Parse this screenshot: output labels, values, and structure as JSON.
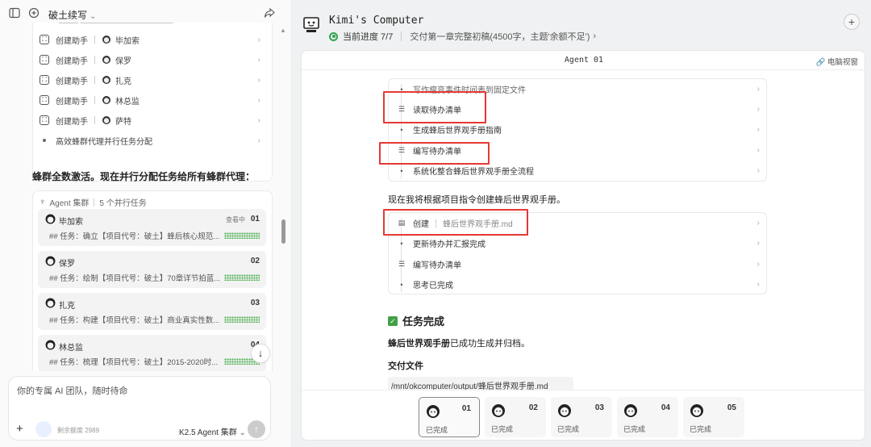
{
  "left": {
    "project_title": "破土续写",
    "card_rows": [
      {
        "type": "helper",
        "label": "创建助手",
        "agent": "毕加索"
      },
      {
        "type": "helper",
        "label": "创建助手",
        "agent": "保罗"
      },
      {
        "type": "helper",
        "label": "创建助手",
        "agent": "扎克"
      },
      {
        "type": "helper",
        "label": "创建助手",
        "agent": "林总监"
      },
      {
        "type": "helper",
        "label": "创建助手",
        "agent": "萨特"
      },
      {
        "type": "bullet",
        "label": "高效蜂群代理并行任务分配"
      }
    ],
    "swarm_message": "蜂群全数激活。现在并行分配任务给所有蜂群代理：",
    "agents_header": {
      "label": "Agent 集群",
      "count": "5 个并行任务"
    },
    "agents": [
      {
        "name": "毕加索",
        "num": "01",
        "view": "查看中",
        "task": "## 任务：确立【项目代号：破土】蜂后核心规范..."
      },
      {
        "name": "保罗",
        "num": "02",
        "view": "",
        "task": "## 任务：绘制【项目代号：破土】70章详节拍蓝..."
      },
      {
        "name": "扎克",
        "num": "03",
        "view": "",
        "task": "## 任务：构建【项目代号：破土】商业真实性数..."
      },
      {
        "name": "林总监",
        "num": "04",
        "view": "",
        "task": "## 任务：梳理【项目代号：破土】2015-2020时..."
      }
    ],
    "input": {
      "placeholder": "你的专属 AI 团队，随时待命",
      "quota": "剩余额度 2989",
      "model": "K2.5 Agent 集群"
    }
  },
  "right": {
    "computer_title": "Kimi's Computer",
    "progress_label": "当前进度 7/7",
    "progress_value": 1.0,
    "progress_desc": "交付第一章完整初稿(4500字，主题'余额不足')",
    "panel_title": "Agent 01",
    "panel_view": "电脑视窗",
    "steps_group1": [
      {
        "marker": "dot",
        "label": "写作瘤变事件时间表到固定文件"
      },
      {
        "marker": "list",
        "label": "读取待办清单"
      },
      {
        "marker": "dot",
        "label": "生成蜂后世界观手册指南"
      },
      {
        "marker": "list",
        "label": "编写待办清单"
      },
      {
        "marker": "dot",
        "label": "系统化整合蜂后世界观手册全流程"
      }
    ],
    "mid_text": "现在我将根据项目指令创建蜂后世界观手册。",
    "steps_group2": [
      {
        "marker": "file",
        "label": "创建",
        "extra": "蜂后世界观手册.md"
      },
      {
        "marker": "dot",
        "label": "更新待办并汇报完成"
      },
      {
        "marker": "list",
        "label": "编写待办清单"
      },
      {
        "marker": "dot",
        "label": "思考已完成"
      }
    ],
    "done_title": "任务完成",
    "done_bold": "蜂后世界观手册",
    "done_rest": "已成功生成并归档。",
    "deliver_label": "交付文件",
    "file_path": "/mnt/okcomputer/output/蜂后世界观手册.md",
    "tiles": [
      {
        "num": "01",
        "status": "已完成"
      },
      {
        "num": "02",
        "status": "已完成"
      },
      {
        "num": "03",
        "status": "已完成"
      },
      {
        "num": "04",
        "status": "已完成"
      },
      {
        "num": "05",
        "status": "已完成"
      }
    ]
  },
  "colors": {
    "accent_green": "#2ea44f",
    "highlight_red": "#e53935"
  }
}
